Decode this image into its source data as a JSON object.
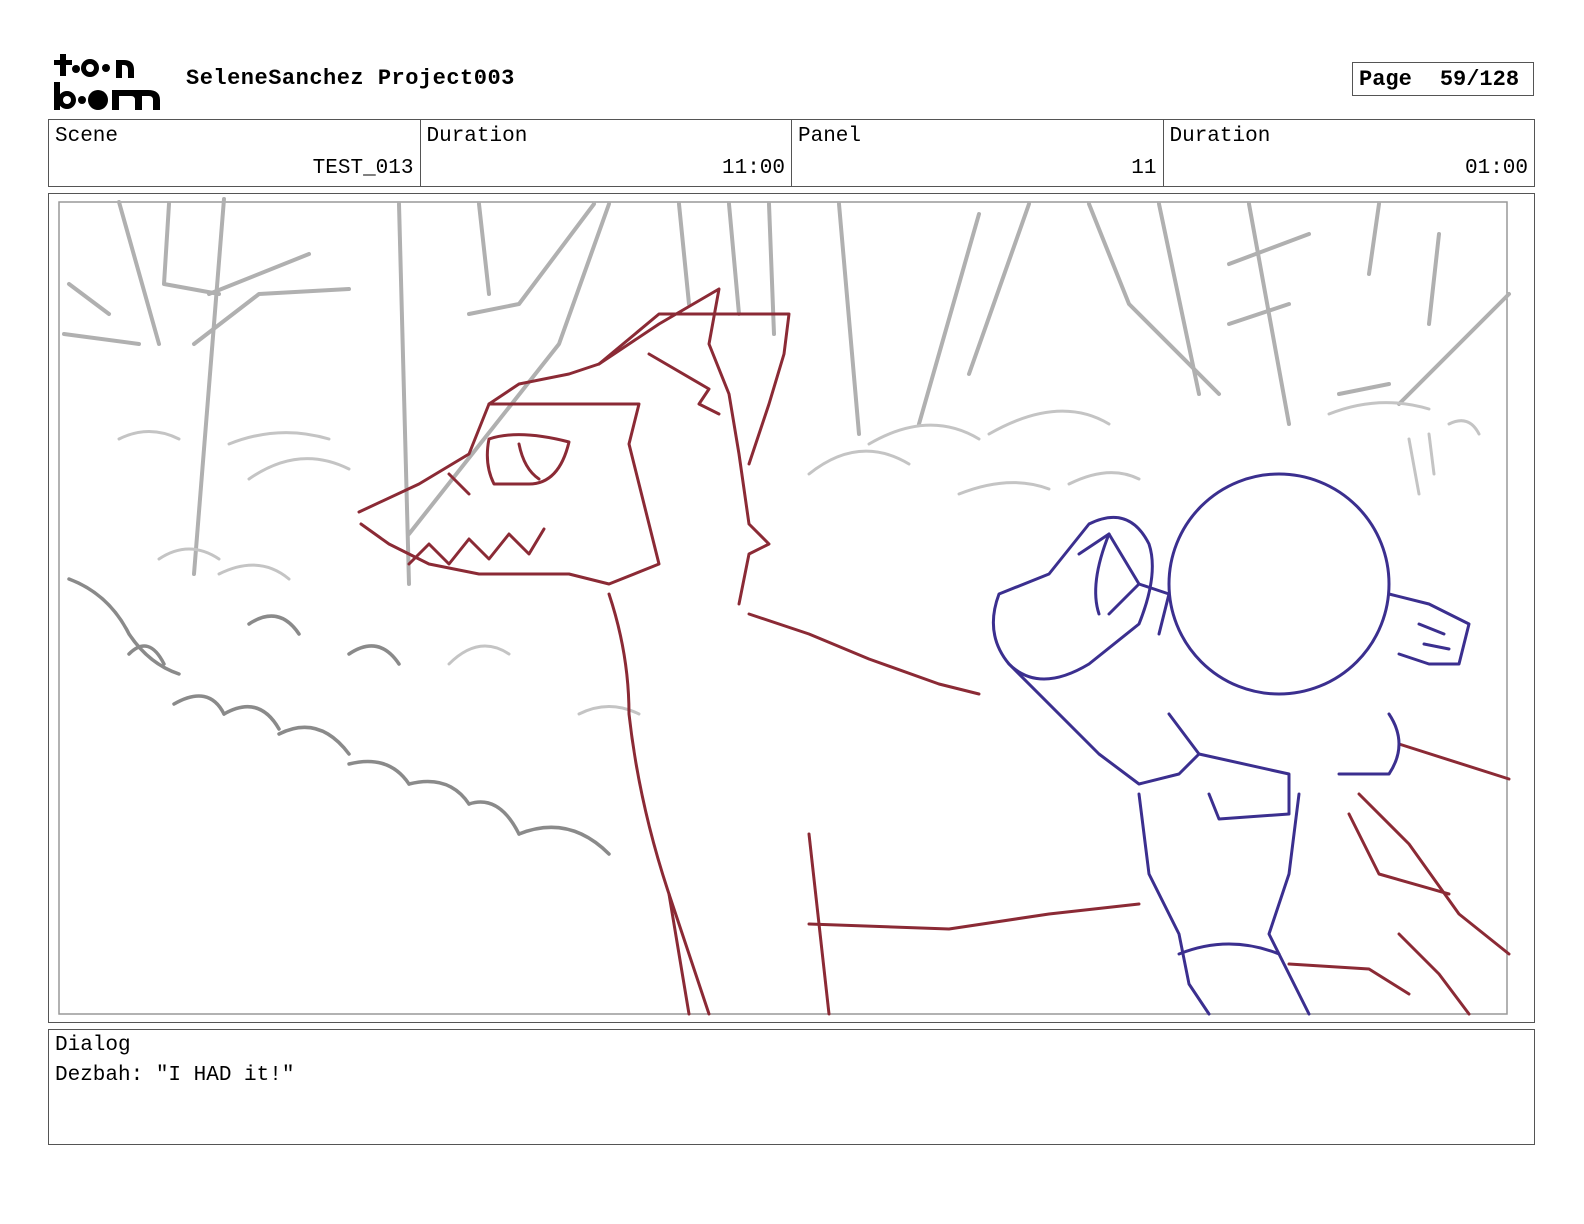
{
  "header": {
    "logo_text": "toon boom",
    "project": "SeleneSanchez Project003",
    "page_label": "Page",
    "page_number": "59/128"
  },
  "info": {
    "scene_label": "Scene",
    "scene_value": "TEST_013",
    "scene_duration_label": "Duration",
    "scene_duration_value": "11:00",
    "panel_label": "Panel",
    "panel_value": "11",
    "panel_duration_label": "Duration",
    "panel_duration_value": "01:00"
  },
  "dialog": {
    "label": "Dialog",
    "text": "Dezbah: \"I HAD it!\""
  },
  "sketch": {
    "background_color": "#b0b0b0",
    "wolf_color": "#8b2a35",
    "girl_color": "#3b2f8f"
  }
}
